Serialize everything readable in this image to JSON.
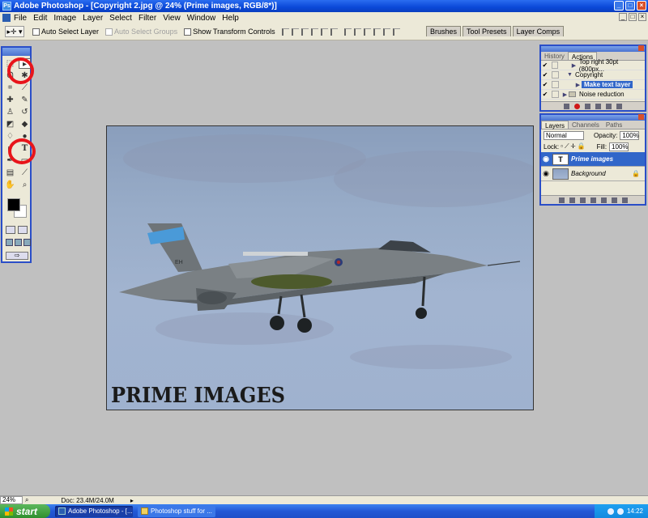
{
  "window": {
    "title": "Adobe Photoshop - [Copyright 2.jpg @ 24% (Prime images, RGB/8*)]"
  },
  "menu": [
    "File",
    "Edit",
    "Image",
    "Layer",
    "Select",
    "Filter",
    "View",
    "Window",
    "Help"
  ],
  "options_bar": {
    "auto_select_layer": "Auto Select Layer",
    "auto_select_groups": "Auto Select Groups",
    "show_transform_controls": "Show Transform Controls"
  },
  "palette_well": [
    "Brushes",
    "Tool Presets",
    "Layer Comps"
  ],
  "document": {
    "watermark_text": "PRIME IMAGES",
    "marking": "EH"
  },
  "actions_panel": {
    "tabs": [
      "History",
      "Actions"
    ],
    "active_tab": "Actions",
    "rows": [
      {
        "arrow": "▶",
        "label": "Top right 30pt (800px...",
        "highlight": false
      },
      {
        "arrow": "▼",
        "label": "Copyright",
        "highlight": false
      },
      {
        "arrow": "▶",
        "label": "Make text layer",
        "highlight": true
      },
      {
        "arrow": "▶",
        "label": "Noise reduction",
        "highlight": false
      }
    ]
  },
  "layers_panel": {
    "tabs": [
      "Layers",
      "Channels",
      "Paths"
    ],
    "active_tab": "Layers",
    "blend_mode": "Normal",
    "opacity_label": "Opacity:",
    "opacity": "100%",
    "lock_label": "Lock:",
    "fill_label": "Fill:",
    "fill": "100%",
    "layers": [
      {
        "name": "Prime images",
        "thumb": "T",
        "active": true
      },
      {
        "name": "Background",
        "thumb": "",
        "active": false
      }
    ]
  },
  "status_bar": {
    "zoom": "24%",
    "doc_info": "Doc: 23.4M/24.0M"
  },
  "taskbar": {
    "start_label": "start",
    "tasks": [
      {
        "label": "Adobe Photoshop - [...",
        "active": true
      },
      {
        "label": "Photoshop stuff for ...",
        "active": false
      }
    ],
    "clock": "14:22"
  },
  "colors": {
    "xp_blue": "#2a4ec8",
    "highlight": "#3166c9",
    "annotation_red": "#e8151a"
  }
}
